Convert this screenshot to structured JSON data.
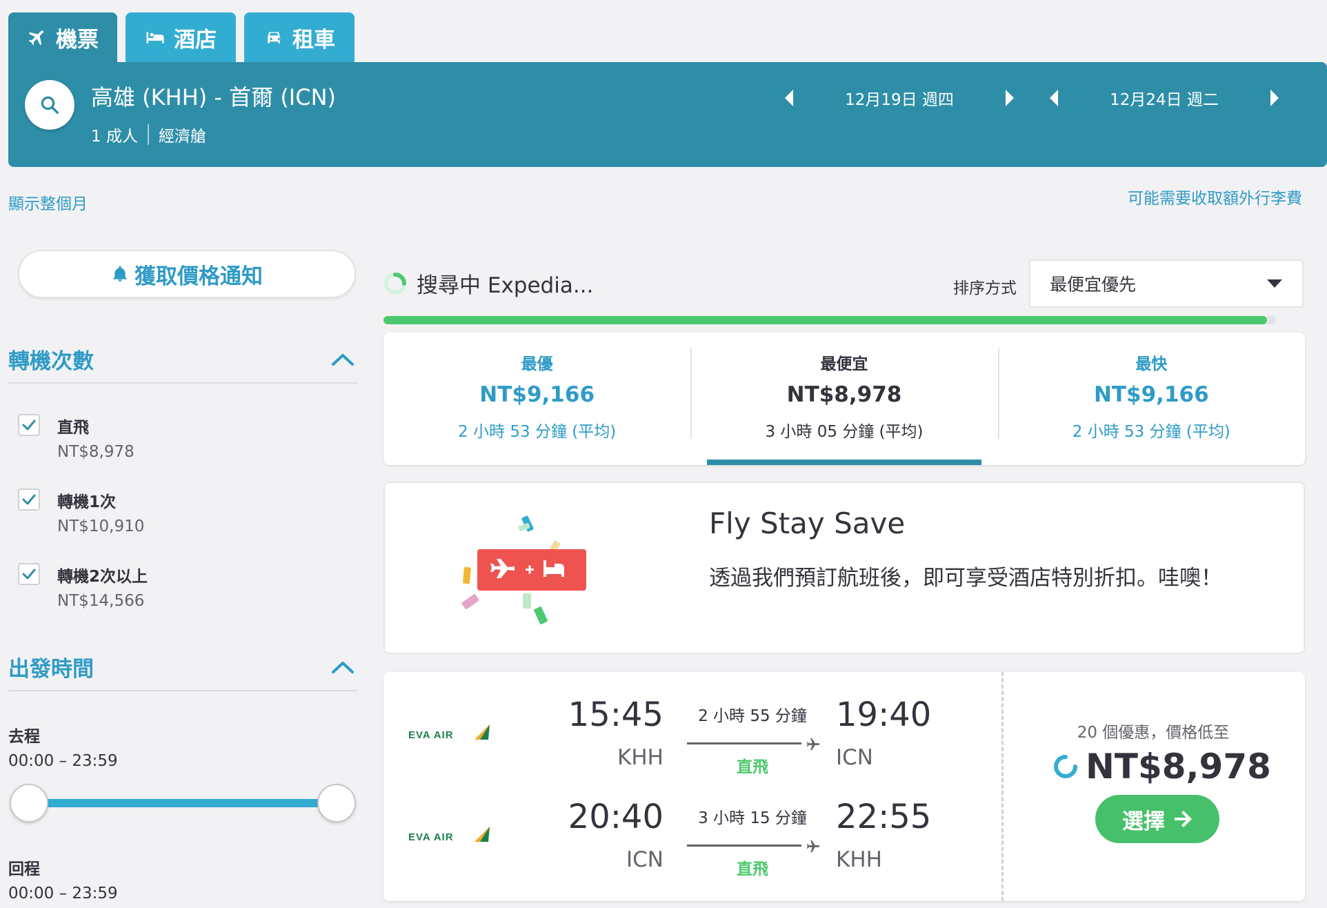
{
  "tabs": [
    {
      "label": "機票",
      "icon": "plane-icon",
      "active": true
    },
    {
      "label": "酒店",
      "icon": "bed-icon",
      "active": false
    },
    {
      "label": "租車",
      "icon": "car-icon",
      "active": false
    }
  ],
  "search": {
    "route": "高雄 (KHH) - 首爾 (ICN)",
    "passengers": "1 成人",
    "cabin": "經濟艙",
    "depart_date": "12月19日 週四",
    "return_date": "12月24日 週二"
  },
  "links": {
    "show_month": "顯示整個月",
    "baggage_fee": "可能需要收取額外行李費"
  },
  "sidebar": {
    "price_alert": "獲取價格通知",
    "stops_title": "轉機次數",
    "stops": [
      {
        "label": "直飛",
        "price": "NT$8,978",
        "checked": true
      },
      {
        "label": "轉機1次",
        "price": "NT$10,910",
        "checked": true
      },
      {
        "label": "轉機2次以上",
        "price": "NT$14,566",
        "checked": true
      }
    ],
    "depart_time_title": "出發時間",
    "outbound_label": "去程",
    "outbound_range": "00:00 – 23:59",
    "return_label": "回程",
    "return_range": "00:00 – 23:59"
  },
  "status": {
    "searching": "搜尋中 Expedia...",
    "progress_fraction": 0.99
  },
  "sort": {
    "label": "排序方式",
    "value": "最便宜優先"
  },
  "summary": [
    {
      "name": "最優",
      "price": "NT$9,166",
      "duration": "2 小時 53 分鐘 (平均)",
      "selected": false
    },
    {
      "name": "最便宜",
      "price": "NT$8,978",
      "duration": "3 小時 05 分鐘 (平均)",
      "selected": true
    },
    {
      "name": "最快",
      "price": "NT$9,166",
      "duration": "2 小時 53 分鐘 (平均)",
      "selected": false
    }
  ],
  "promo": {
    "title": "Fly Stay Save",
    "text": "透過我們預訂航班後，即可享受酒店特別折扣。哇噢！"
  },
  "result": {
    "legs": [
      {
        "airline": "EVA AIR",
        "dep_time": "15:45",
        "dep_airport": "KHH",
        "duration": "2 小時 55 分鐘",
        "stops": "直飛",
        "arr_time": "19:40",
        "arr_airport": "ICN"
      },
      {
        "airline": "EVA AIR",
        "dep_time": "20:40",
        "dep_airport": "ICN",
        "duration": "3 小時 15 分鐘",
        "stops": "直飛",
        "arr_time": "22:55",
        "arr_airport": "KHH"
      }
    ],
    "deals": "20 個優惠，價格低至",
    "price": "NT$8,978",
    "select_label": "選擇"
  },
  "colors": {
    "primary": "#2e8ea8",
    "tab": "#33acd2",
    "link": "#2e9bc6",
    "success": "#46c06a",
    "promo_red": "#ef5350"
  }
}
